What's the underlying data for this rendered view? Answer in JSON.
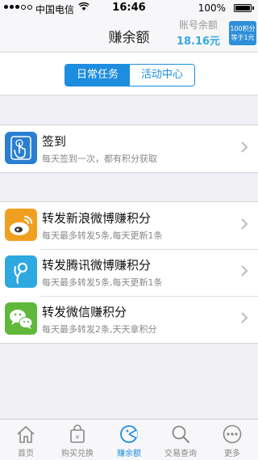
{
  "status_bar": {
    "carrier": "中国电信",
    "time": "16:46",
    "battery": "100%"
  },
  "nav": {
    "title": "赚余额",
    "balance_label": "账号余额",
    "balance_amount": "18.16元",
    "points_badge_line1": "100积分",
    "points_badge_line2": "等于1元"
  },
  "segments": {
    "daily": "日常任务",
    "events": "活动中心",
    "active": "daily"
  },
  "checkin": {
    "title": "签到",
    "subtitle": "每天签到一次，都有积分获取",
    "icon": "finger-tap-icon"
  },
  "share_tasks": [
    {
      "title": "转发新浪微博赚积分",
      "subtitle": "每天最多转发5条,每天更新1条",
      "icon": "sina-weibo-icon",
      "color": "#f0a020"
    },
    {
      "title": "转发腾讯微博赚积分",
      "subtitle": "每天最多转发5条,每天更新1条",
      "icon": "tencent-weibo-icon",
      "color": "#2da8e0"
    },
    {
      "title": "转发微信赚积分",
      "subtitle": "每天最多转发2条,天天拿积分",
      "icon": "wechat-icon",
      "color": "#5fb83a"
    }
  ],
  "tabs": [
    {
      "label": "首页",
      "icon": "home-icon"
    },
    {
      "label": "购买兑换",
      "icon": "shopping-bag-icon"
    },
    {
      "label": "赚余额",
      "icon": "earn-icon",
      "active": true
    },
    {
      "label": "交易查询",
      "icon": "search-icon"
    },
    {
      "label": "更多",
      "icon": "more-icon"
    }
  ],
  "colors": {
    "accent": "#1d8de0",
    "balance": "#36a8e0"
  }
}
